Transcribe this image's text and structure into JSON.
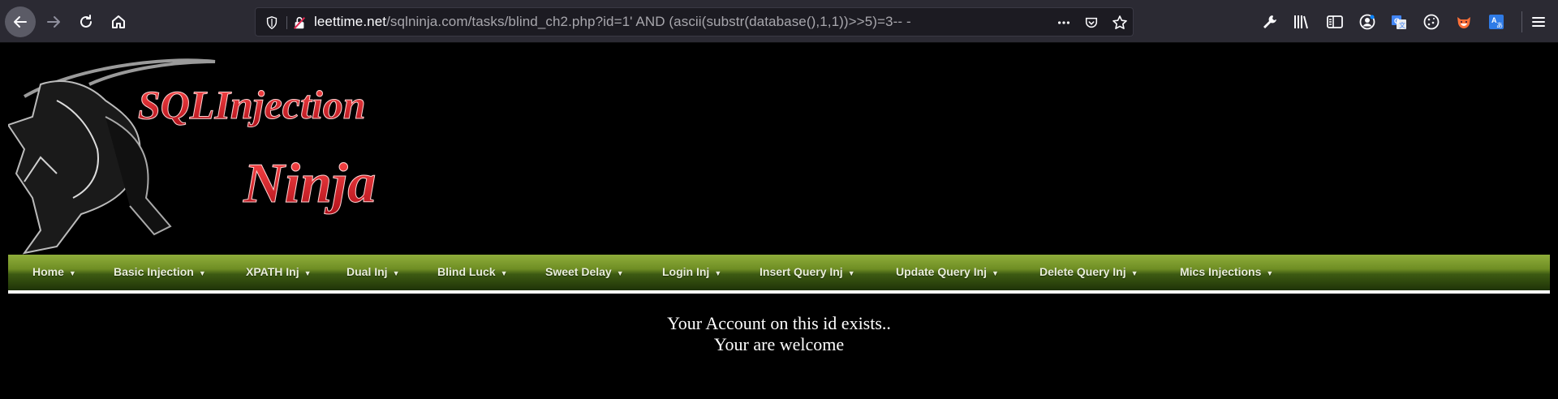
{
  "browser": {
    "url_domain": "leettime.net",
    "url_path": "/sqlninja.com/tasks/blind_ch2.php?id=1' AND (ascii(substr(database(),1,1))>>5)=3-- -",
    "icons": {
      "back": "back-arrow-icon",
      "forward": "forward-arrow-icon",
      "reload": "reload-icon",
      "home": "home-icon",
      "tracking": "tracking-shield-icon",
      "insecure": "insecure-lock-icon",
      "more": "more-dots-icon",
      "pocket": "pocket-icon",
      "bookmark": "bookmark-star-icon"
    },
    "extensions": [
      "wrench-icon",
      "library-icon",
      "sidebar-icon",
      "account-icon",
      "translate-icon",
      "cookie-icon",
      "fox-extension-icon",
      "translator-icon",
      "menu-icon"
    ]
  },
  "banner": {
    "line1": "SQLInjection",
    "line2": "Ninja"
  },
  "nav": {
    "items": [
      {
        "label": "Home"
      },
      {
        "label": "Basic Injection"
      },
      {
        "label": "XPATH Inj"
      },
      {
        "label": "Dual Inj"
      },
      {
        "label": "Blind Luck"
      },
      {
        "label": "Sweet Delay"
      },
      {
        "label": "Login Inj"
      },
      {
        "label": "Insert Query Inj"
      },
      {
        "label": "Update Query Inj"
      },
      {
        "label": "Delete Query Inj"
      },
      {
        "label": "Mics Injections"
      }
    ],
    "caret": "▼"
  },
  "content": {
    "line1": "Your Account on this id exists..",
    "line2": "Your are welcome"
  },
  "colors": {
    "accent_red": "#e0202a",
    "nav_green": "#6f8e24",
    "chrome_bg": "#2b2a33"
  }
}
